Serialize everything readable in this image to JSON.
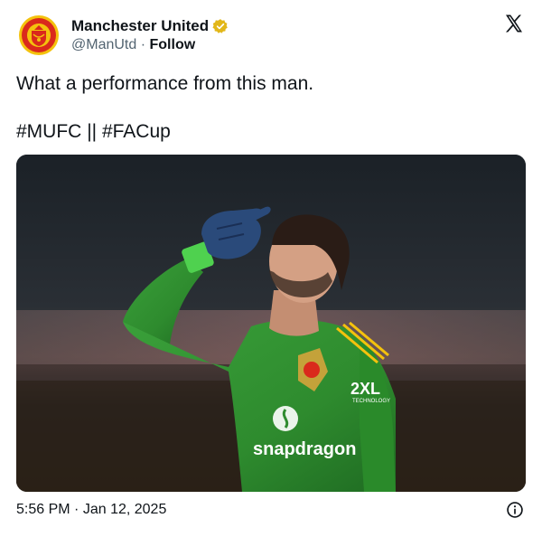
{
  "author": {
    "display_name": "Manchester United",
    "handle": "@ManUtd",
    "separator": "·",
    "follow_label": "Follow",
    "verified_color": "#e2b719"
  },
  "tweet": {
    "line1": "What a performance from this man.",
    "hashtags": [
      "#MUFC",
      "||",
      "#FACup"
    ]
  },
  "media": {
    "icon": "photo",
    "sponsor_text": "snapdragon",
    "kit_text": "2XL",
    "kit_subtext": "TECHNOLOGY"
  },
  "footer": {
    "time": "5:56 PM",
    "separator": "·",
    "date": "Jan 12, 2025"
  },
  "colors": {
    "jersey_green": "#2e8b2e",
    "glove_blue": "#2a4a7a",
    "badge_red": "#da291c",
    "badge_gold": "#f4c20d"
  }
}
